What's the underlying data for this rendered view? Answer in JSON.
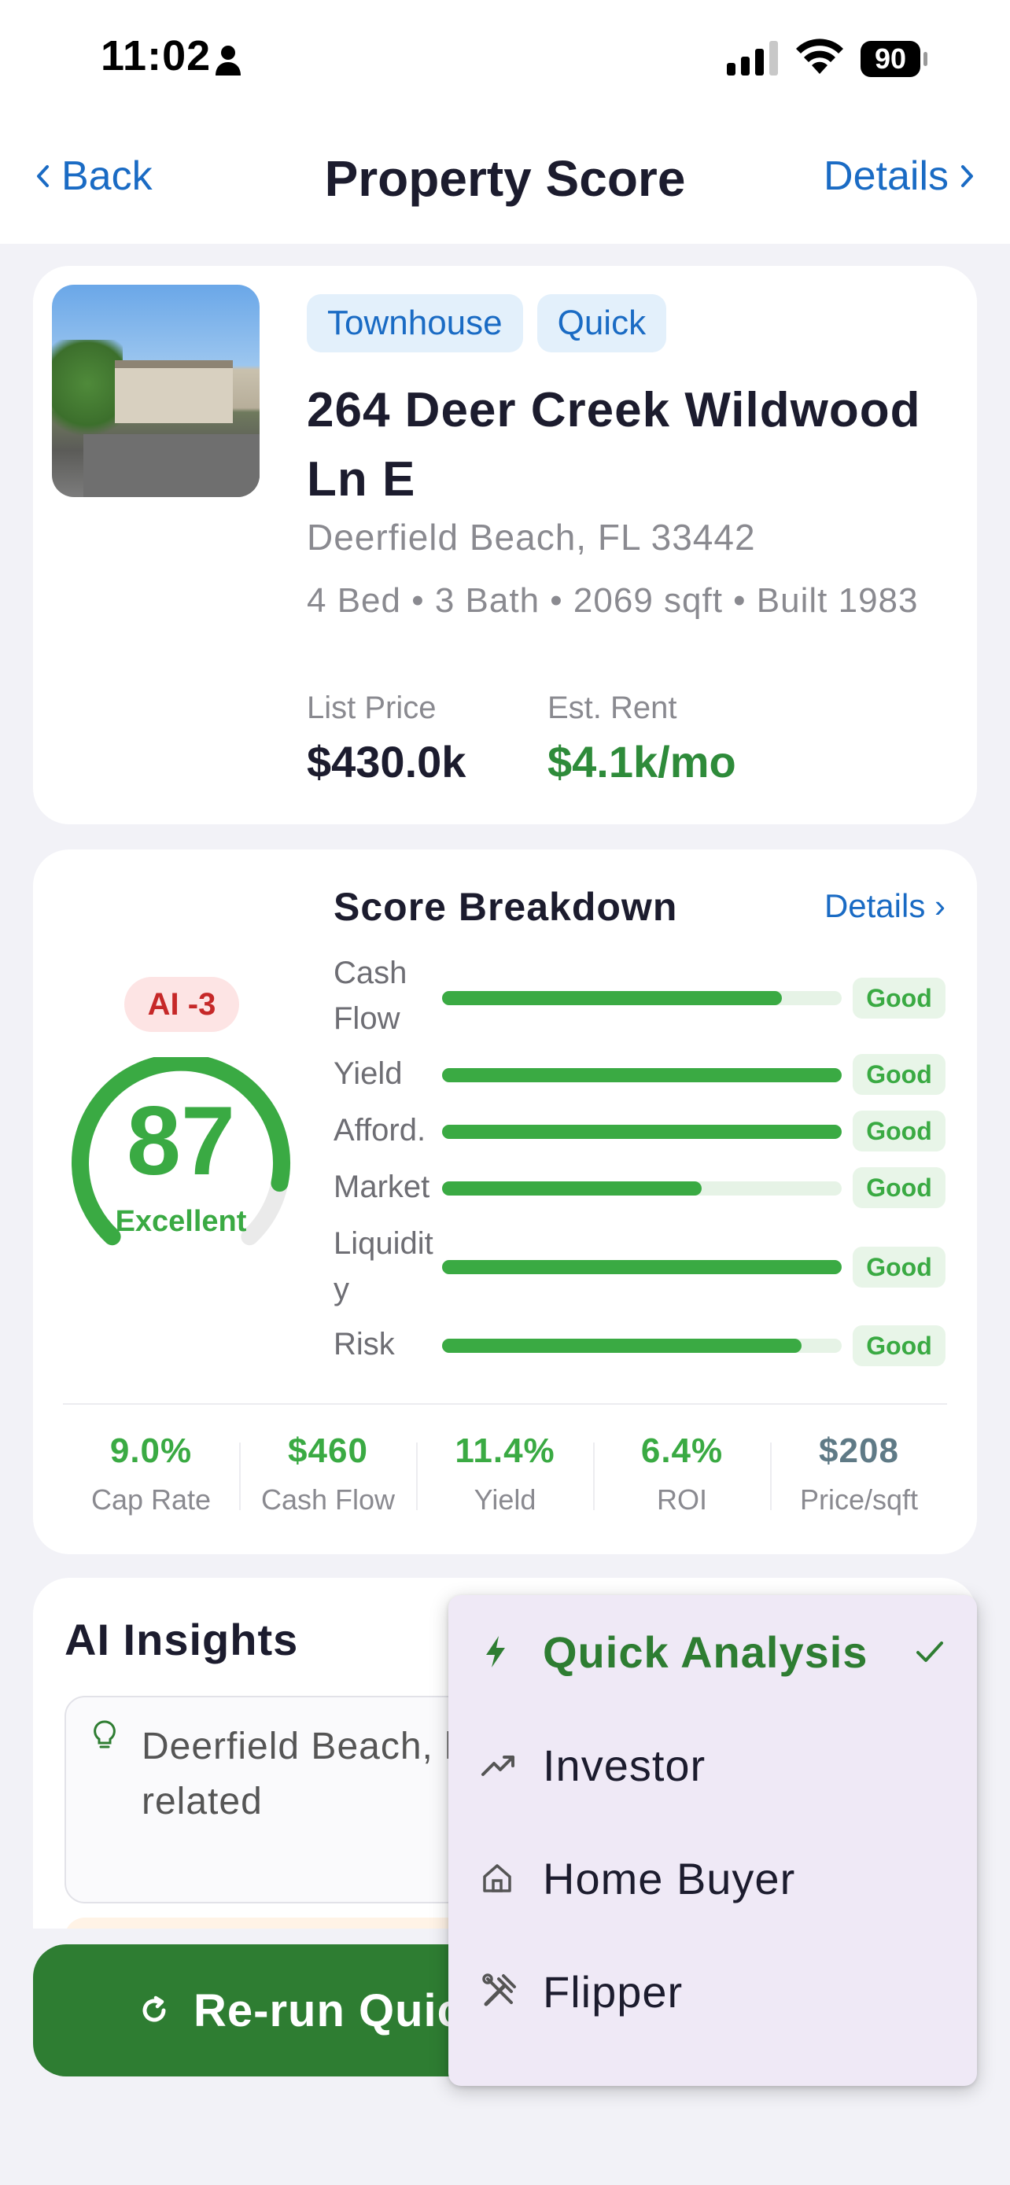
{
  "status_bar": {
    "time": "11:02",
    "battery": "90"
  },
  "nav": {
    "back_label": "Back",
    "title": "Property Score",
    "details_label": "Details"
  },
  "property": {
    "tags": [
      "Townhouse",
      "Quick"
    ],
    "address": "264 Deer Creek Wildwood Ln E",
    "city": "Deerfield Beach, FL 33442",
    "specs": "4 Bed • 3 Bath • 2069 sqft • Built 1983",
    "list_price_label": "List Price",
    "list_price": "$430.0k",
    "est_rent_label": "Est. Rent",
    "est_rent": "$4.1k/mo"
  },
  "score": {
    "ai_badge": "AI -3",
    "value": "87",
    "rating": "Excellent",
    "gauge_fraction": 0.87,
    "breakdown_title": "Score Breakdown",
    "breakdown_details": "Details ›",
    "breakdown": [
      {
        "label": "Cash Flow",
        "fill": 0.85,
        "status": "Good"
      },
      {
        "label": "Yield",
        "fill": 1.0,
        "status": "Good"
      },
      {
        "label": "Afford.",
        "fill": 1.0,
        "status": "Good"
      },
      {
        "label": "Market",
        "fill": 0.65,
        "status": "Good"
      },
      {
        "label": "Liquidity",
        "fill": 1.0,
        "status": "Good"
      },
      {
        "label": "Risk",
        "fill": 0.9,
        "status": "Good"
      }
    ],
    "metrics": [
      {
        "value": "9.0%",
        "label": "Cap Rate",
        "color": "#3aaa43"
      },
      {
        "value": "$460",
        "label": "Cash Flow",
        "color": "#3aaa43"
      },
      {
        "value": "11.4%",
        "label": "Yield",
        "color": "#3aaa43"
      },
      {
        "value": "6.4%",
        "label": "ROI",
        "color": "#3aaa43"
      },
      {
        "value": "$208",
        "label": "Price/sqft",
        "color": "#5f7a86"
      }
    ]
  },
  "insights": {
    "title": "AI Insights",
    "text": "Deerfield Beach, location but coas weather-related"
  },
  "rerun_button": {
    "label": "Re-run Quic"
  },
  "menu": {
    "items": [
      {
        "label": "Quick Analysis",
        "icon": "bolt-icon",
        "selected": true
      },
      {
        "label": "Investor",
        "icon": "trending-up-icon",
        "selected": false
      },
      {
        "label": "Home Buyer",
        "icon": "home-icon",
        "selected": false
      },
      {
        "label": "Flipper",
        "icon": "tools-icon",
        "selected": false
      }
    ]
  },
  "colors": {
    "accent": "#1a6bc4",
    "good": "#3aaa43",
    "primary_button": "#2e7d32",
    "danger": "#c62828"
  }
}
